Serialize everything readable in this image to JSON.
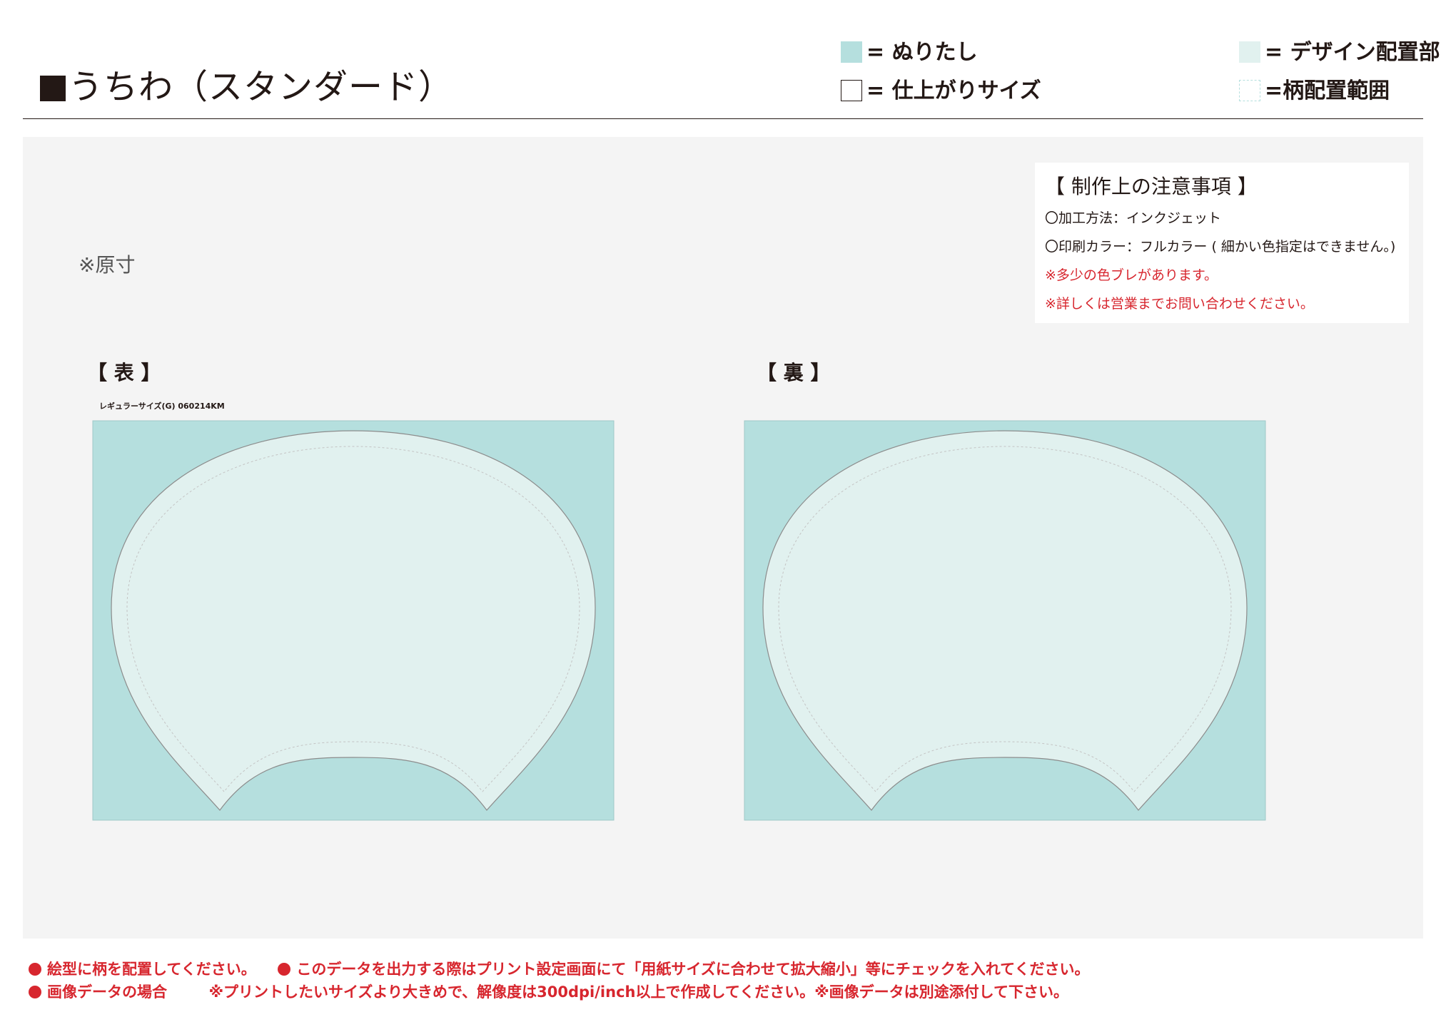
{
  "header": {
    "title": "うちわ（スタンダード）",
    "legend": {
      "bleed": "= ぬりたし",
      "finished_size": "= 仕上がりサイズ",
      "design_area": "= デザイン配置部",
      "pattern_range": "=柄配置範囲"
    }
  },
  "panel": {
    "actual_size": "※原寸",
    "notes": {
      "title": "【 制作上の注意事項 】",
      "items": [
        "〇加工方法：インクジェット",
        "〇印刷カラー：フルカラー ( 細かい色指定はできません。)",
        "※多少の色ブレがあります。",
        "※詳しくは営業までお問い合わせください。"
      ]
    },
    "front": {
      "label": "【 表 】",
      "template_code": "レギュラーサイズ(G)  060214KM"
    },
    "back": {
      "label": "【 裏 】"
    }
  },
  "footer": {
    "line1_a": "絵型に柄を配置してください。",
    "line1_b": "このデータを出力する際はプリント設定画面にて「用紙サイズに合わせて拡大縮小」等にチェックを入れてください。",
    "line2_a": "画像データの場合",
    "line2_b": "※プリントしたいサイズより大きめで、解像度は300dpi/inch以上で作成してください。※画像データは別途添付して下さい。"
  },
  "colors": {
    "bleed": "#b5dfde",
    "design_area": "#e1f1ef",
    "panel_bg": "#f4f4f4",
    "warning_red": "#d7262e",
    "text": "#231815"
  }
}
